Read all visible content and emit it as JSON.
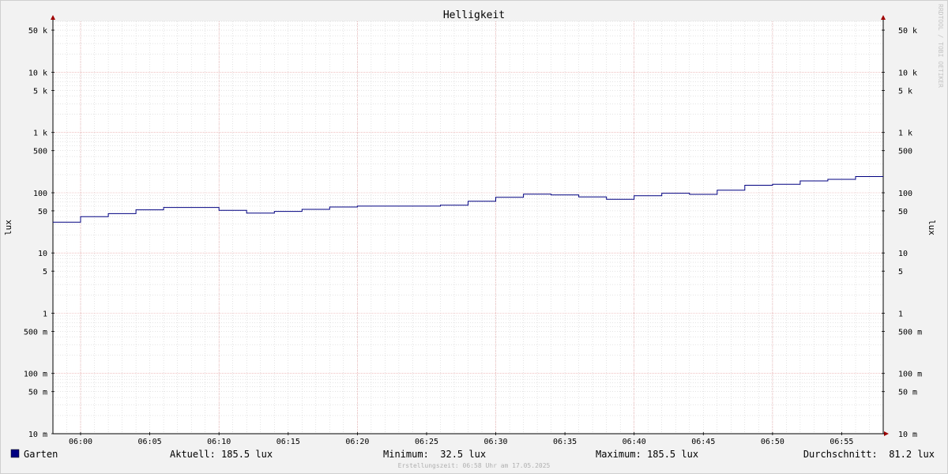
{
  "chart_data": {
    "type": "line",
    "title": "Helligkeit",
    "ylabel": "lux",
    "ylabel_right": "lux",
    "yscale": "log",
    "ylim": [
      0.01,
      70000
    ],
    "y_ticks": [
      {
        "value": 50000,
        "label": "50 k"
      },
      {
        "value": 10000,
        "label": "10 k"
      },
      {
        "value": 5000,
        "label": "5 k"
      },
      {
        "value": 1000,
        "label": "1 k"
      },
      {
        "value": 500,
        "label": "500"
      },
      {
        "value": 100,
        "label": "100"
      },
      {
        "value": 50,
        "label": "50"
      },
      {
        "value": 10,
        "label": "10"
      },
      {
        "value": 5,
        "label": "5"
      },
      {
        "value": 1,
        "label": "1"
      },
      {
        "value": 0.5,
        "label": "500 m"
      },
      {
        "value": 0.1,
        "label": "100 m"
      },
      {
        "value": 0.05,
        "label": "50 m"
      },
      {
        "value": 0.01,
        "label": "10 m"
      }
    ],
    "x_start": "05:58",
    "x_end": "06:58",
    "x_ticks": [
      "06:00",
      "06:05",
      "06:10",
      "06:15",
      "06:20",
      "06:25",
      "06:30",
      "06:35",
      "06:40",
      "06:45",
      "06:50",
      "06:55"
    ],
    "grid": true,
    "series": [
      {
        "name": "Garten",
        "color": "#000080",
        "step": true,
        "points": [
          {
            "x": "05:58",
            "y": 32.5
          },
          {
            "x": "06:00",
            "y": 40
          },
          {
            "x": "06:02",
            "y": 45
          },
          {
            "x": "06:04",
            "y": 52
          },
          {
            "x": "06:06",
            "y": 57
          },
          {
            "x": "06:08",
            "y": 57
          },
          {
            "x": "06:10",
            "y": 51
          },
          {
            "x": "06:12",
            "y": 46
          },
          {
            "x": "06:14",
            "y": 49
          },
          {
            "x": "06:16",
            "y": 53
          },
          {
            "x": "06:18",
            "y": 58
          },
          {
            "x": "06:20",
            "y": 60
          },
          {
            "x": "06:22",
            "y": 60
          },
          {
            "x": "06:24",
            "y": 60
          },
          {
            "x": "06:26",
            "y": 62
          },
          {
            "x": "06:28",
            "y": 72
          },
          {
            "x": "06:30",
            "y": 84
          },
          {
            "x": "06:32",
            "y": 95
          },
          {
            "x": "06:34",
            "y": 92
          },
          {
            "x": "06:36",
            "y": 85
          },
          {
            "x": "06:38",
            "y": 78
          },
          {
            "x": "06:40",
            "y": 89
          },
          {
            "x": "06:42",
            "y": 98
          },
          {
            "x": "06:44",
            "y": 94
          },
          {
            "x": "06:46",
            "y": 110
          },
          {
            "x": "06:48",
            "y": 133
          },
          {
            "x": "06:50",
            "y": 138
          },
          {
            "x": "06:52",
            "y": 157
          },
          {
            "x": "06:54",
            "y": 167
          },
          {
            "x": "06:56",
            "y": 185.5
          },
          {
            "x": "06:58",
            "y": 185.5
          }
        ]
      }
    ]
  },
  "legend": {
    "series_name": "Garten",
    "swatch_color": "#000080",
    "current": "Aktuell: 185.5 lux",
    "minimum": "Minimum:  32.5 lux",
    "maximum": "Maximum: 185.5 lux",
    "average": "Durchschnitt:  81.2 lux"
  },
  "footer": "Erstellungszeit: 06:58 Uhr am 17.05.2025",
  "watermark": "RRDTOOL / TOBI OETIKER",
  "colors": {
    "background": "#f2f2f2",
    "plot_background": "#ffffff",
    "major_grid": "#e59a9a",
    "minor_grid": "#c8c8c8",
    "axis": "#000000",
    "arrow": "#a00000"
  }
}
